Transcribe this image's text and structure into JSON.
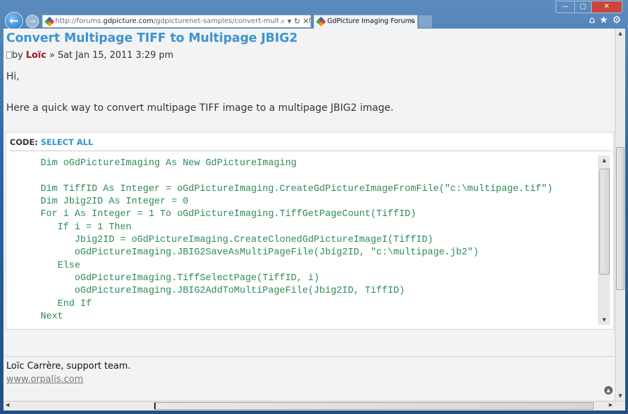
{
  "browser": {
    "url_prefix": "http://forums.",
    "url_domain": "gdpicture.com",
    "url_path": "/gdpicturenet-samples/convert-multipage-tiff-m",
    "url_controls": "⌕ ▾ ↻ ✕",
    "tab_title": "GdPicture Imaging Forums ...",
    "tab_close": "✕",
    "back": "←",
    "forward": "→",
    "minimize": "—",
    "maximize": "▢",
    "close": "✕",
    "home": "⌂",
    "favorites": "★",
    "tools": "⚙"
  },
  "post": {
    "title": "Convert Multipage TIFF to Multipage JBIG2",
    "by": "by",
    "author": "Loïc",
    "date": "» Sat Jan 15, 2011 3:29 pm",
    "greeting": "Hi,",
    "intro": "Here a quick way to convert multipage TIFF image to a multipage JBIG2 image.",
    "code_label": "CODE: ",
    "select_all": "SELECT ALL",
    "code_lines": [
      "      Dim oGdPictureImaging As New GdPictureImaging",
      "",
      "      Dim TiffID As Integer = oGdPictureImaging.CreateGdPictureImageFromFile(\"c:\\multipage.tif\")",
      "      Dim Jbig2ID As Integer = 0",
      "      For i As Integer = 1 To oGdPictureImaging.TiffGetPageCount(TiffID)",
      "         If i = 1 Then",
      "            Jbig2ID = oGdPictureImaging.CreateClonedGdPictureImageI(TiffID)",
      "            oGdPictureImaging.JBIG2SaveAsMultiPageFile(Jbig2ID, \"c:\\multipage.jb2\")",
      "         Else",
      "            oGdPictureImaging.TiffSelectPage(TiffID, i)",
      "            oGdPictureImaging.JBIG2AddToMultiPageFile(Jbig2ID, TiffID)",
      "         End If",
      "      Next"
    ],
    "signature": "Loïc Carrère, support team.",
    "website": "www.orpalis.com"
  }
}
